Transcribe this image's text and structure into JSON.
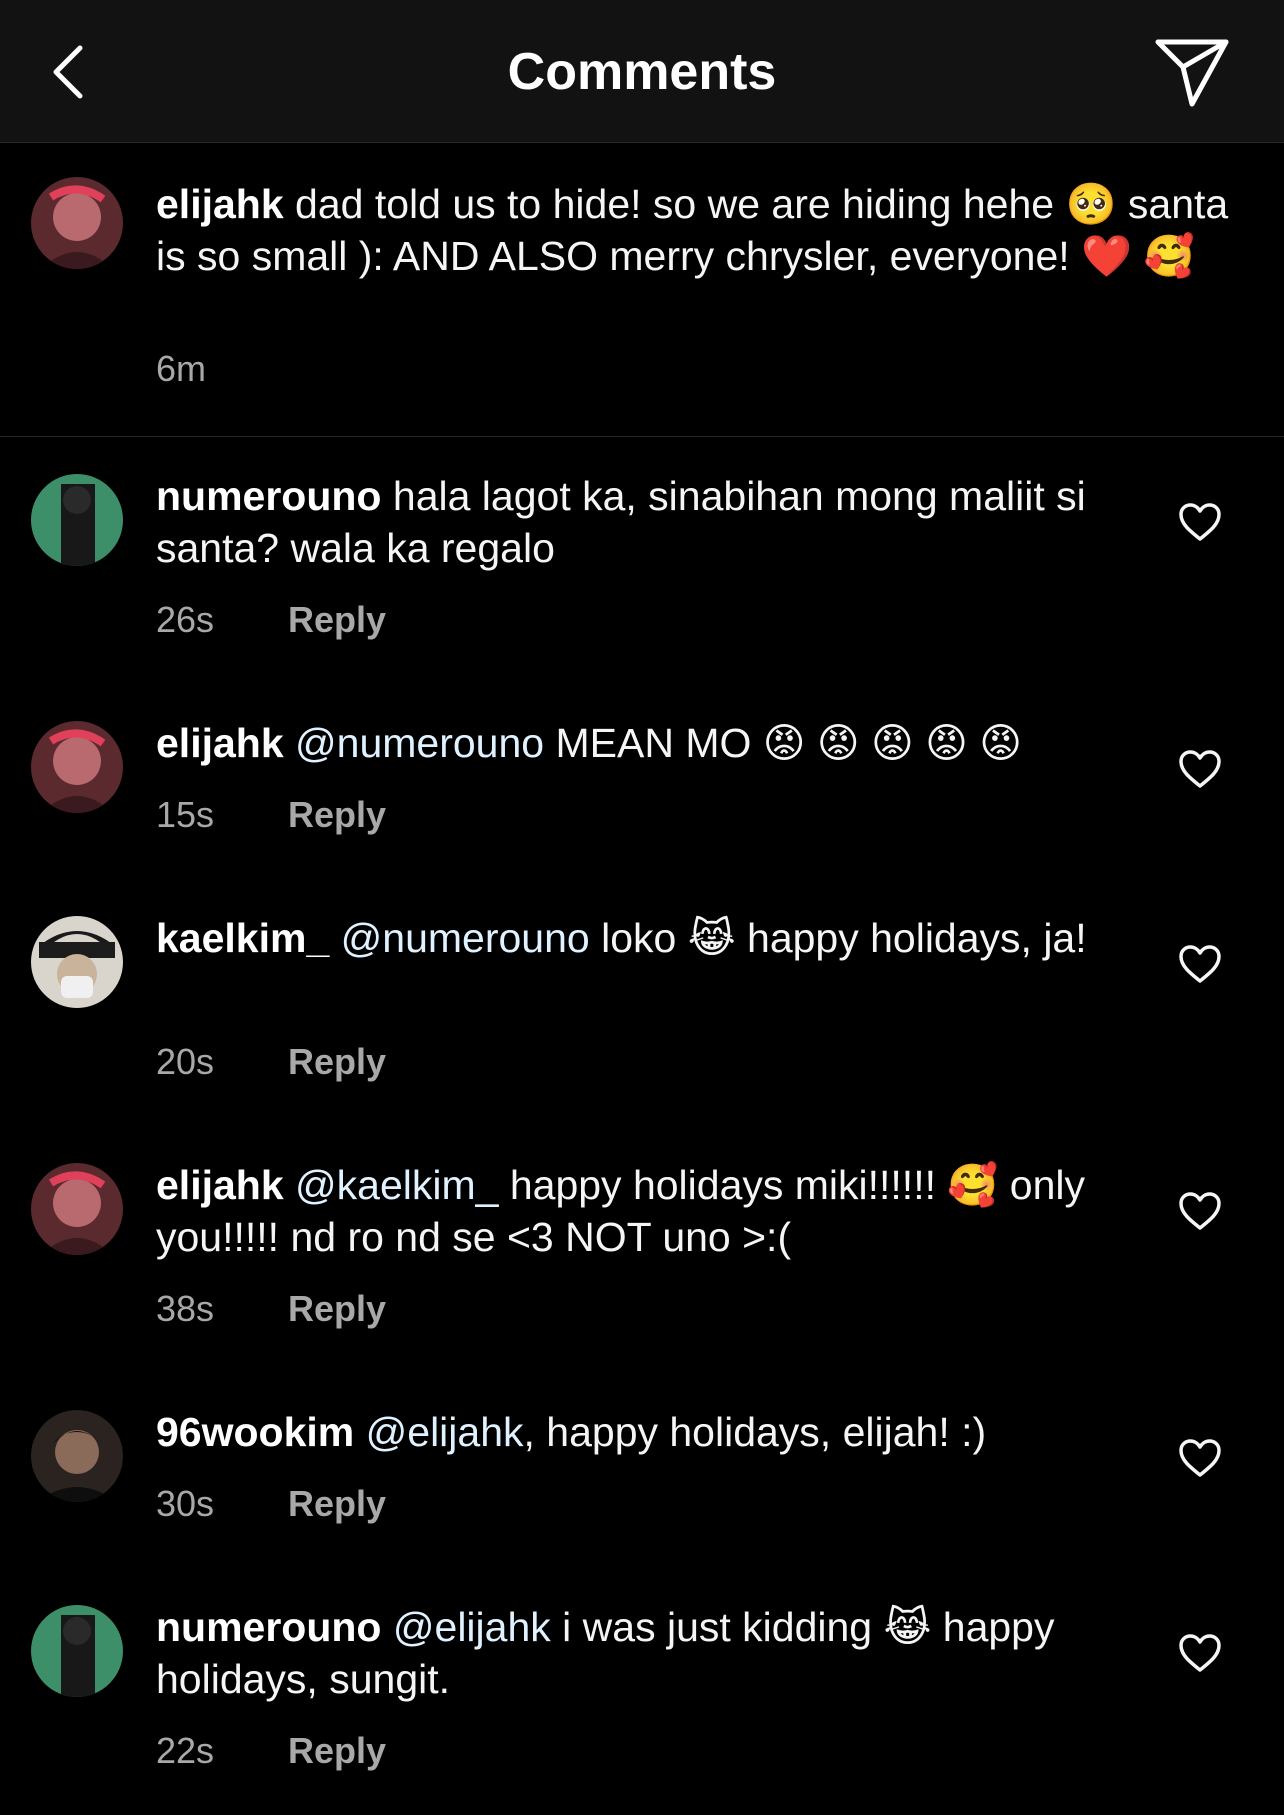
{
  "header": {
    "title": "Comments",
    "back_icon": "chevron-left-icon",
    "send_icon": "paper-plane-icon"
  },
  "caption": {
    "username": "elijahk",
    "text": "dad told us to hide! so we are hiding hehe 🥺 santa is so small ): AND ALSO merry chrysler, everyone! ❤️ 🥰",
    "time": "6m"
  },
  "comments": [
    {
      "username": "numerouno",
      "mention": "",
      "text": "hala lagot ka, sinabihan mong maliit si santa? wala ka regalo",
      "time": "26s",
      "reply_label": "Reply"
    },
    {
      "username": "elijahk",
      "mention": "@numerouno",
      "text": "MEAN MO 😡 😡 😡 😡 😡",
      "time": "15s",
      "reply_label": "Reply"
    },
    {
      "username": "kaelkim_",
      "mention": "@numerouno",
      "text": "loko 😹 happy holidays, ja!",
      "time": "20s",
      "reply_label": "Reply"
    },
    {
      "username": "elijahk",
      "mention": "@kaelkim_",
      "text": "happy holidays miki!!!!!! 🥰 only you!!!!! nd ro nd se <3 NOT uno >:(",
      "time": "38s",
      "reply_label": "Reply"
    },
    {
      "username": "96wookim",
      "mention": "@elijahk",
      "text": ", happy holidays, elijah! :)",
      "time": "30s",
      "reply_label": "Reply"
    },
    {
      "username": "numerouno",
      "mention": "@elijahk",
      "text": "i was just kidding 😹 happy holidays, sungit.",
      "time": "22s",
      "reply_label": "Reply"
    }
  ]
}
